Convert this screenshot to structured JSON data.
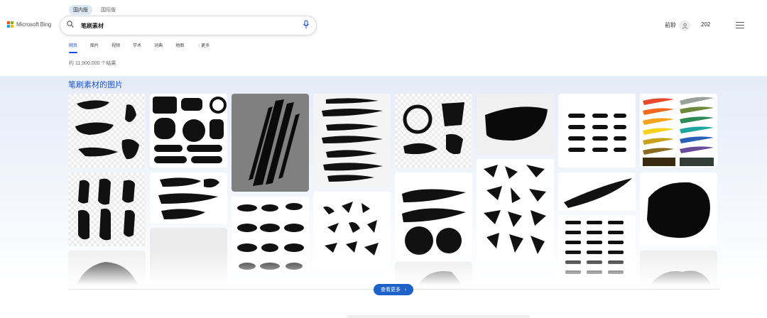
{
  "region_tabs": [
    "国内版",
    "国际版"
  ],
  "brand": {
    "name": "Microsoft Bing",
    "colors": [
      "#f25022",
      "#7fba00",
      "#00a4ef",
      "#ffb900"
    ]
  },
  "search": {
    "query": "笔刷素材"
  },
  "header": {
    "signin": "前聆",
    "rewards": "202"
  },
  "nav": [
    "网页",
    "图片",
    "视频",
    "学术",
    "词典",
    "地图",
    "更多"
  ],
  "results": {
    "count_text": "约 11,900,000 个结果"
  },
  "images": {
    "title": "笔刷素材的图片",
    "more_label": "查看更多"
  },
  "accent_color": "#174ae4"
}
